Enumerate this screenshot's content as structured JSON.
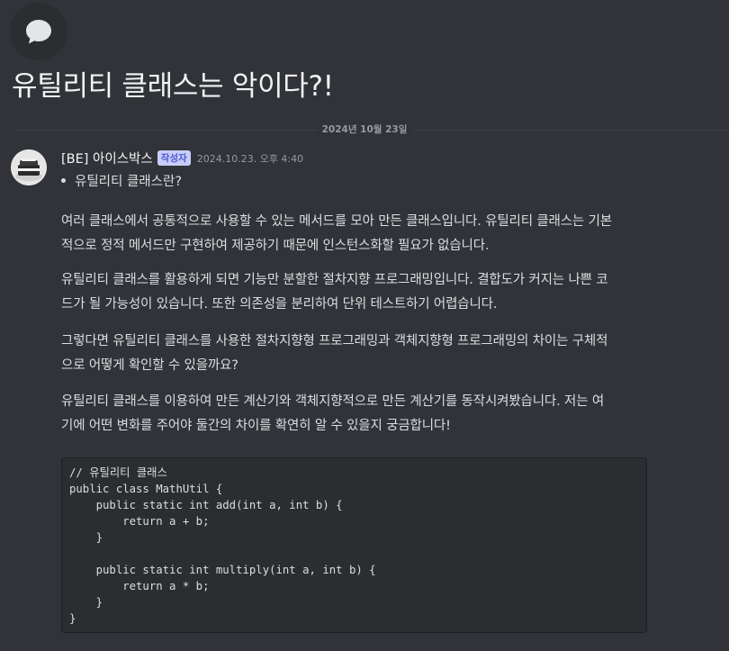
{
  "thread": {
    "icon": "speech-bubble-icon",
    "title": "유틸리티 클래스는 악이다?!"
  },
  "date_divider": "2024년 10월 23일",
  "message": {
    "author": "[BE] 아이스박스",
    "badge": "작성자",
    "timestamp": "2024.10.23. 오후 4:40",
    "bullet": "유틸리티 클래스란?",
    "paragraphs": [
      [
        "여러 클래스에서 공통적으로 사용할 수 있는 메서드를 모아 만든 클래스입니다. 유틸리티 클래스는 기본",
        "적으로 정적 메서드만 구현하여 제공하기 때문에 인스턴스화할 필요가 없습니다."
      ],
      [
        "유틸리티 클래스를 활용하게 되면 기능만 분할한 절차지향 프로그래밍입니다. 결합도가 커지는 나쁜 코",
        "드가 될 가능성이 있습니다. 또한 의존성을 분리하여 단위 테스트하기 어렵습니다."
      ],
      [
        "그렇다면 유틸리티 클래스를 사용한 절차지향형 프로그래밍과 객체지향형 프로그래밍의 차이는 구체적",
        "으로 어떻게 확인할 수 있을까요?"
      ],
      [
        "유틸리티 클래스를 이용하여 만든 계산기와 객체지향적으로 만든 계산기를 동작시켜봤습니다. 저는 여",
        "기에 어떤 변화를 주어야 둘간의 차이를 확연히 알 수 있을지 궁금합니다!"
      ]
    ],
    "code_lines": [
      "// 유틸리티 클래스",
      "public class MathUtil {",
      "    public static int add(int a, int b) {",
      "        return a + b;",
      "    }",
      "",
      "    public static int multiply(int a, int b) {",
      "        return a * b;",
      "    }",
      "}"
    ]
  },
  "colors": {
    "background": "#313338",
    "code_background": "#2b2d31",
    "badge_background": "#c9cdfb",
    "badge_text": "#4e5acf",
    "muted_text": "#949ba4"
  }
}
